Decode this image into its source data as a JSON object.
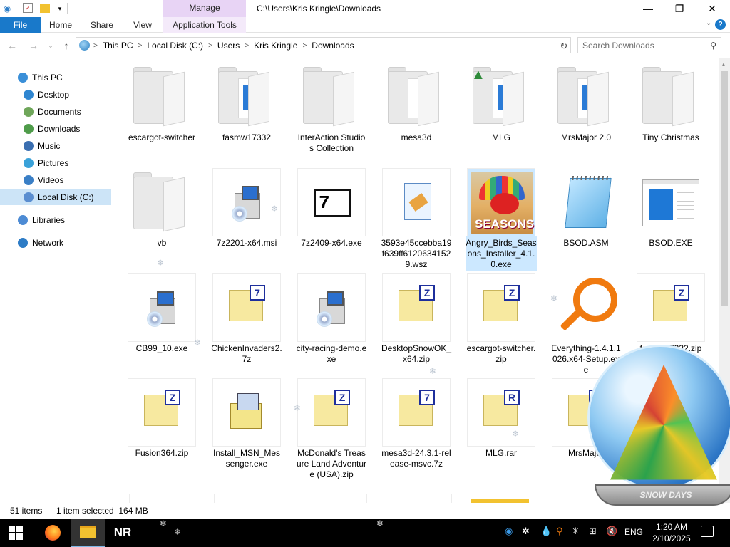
{
  "title_bar": {
    "manage_tab": "Manage",
    "path": "C:\\Users\\Kris Kringle\\Downloads"
  },
  "ribbon": {
    "tabs": [
      "File",
      "Home",
      "Share",
      "View",
      "Application Tools"
    ]
  },
  "address": {
    "crumbs": [
      "This PC",
      "Local Disk (C:)",
      "Users",
      "Kris Kringle",
      "Downloads"
    ],
    "search_placeholder": "Search Downloads"
  },
  "nav": {
    "items": [
      {
        "label": "This PC",
        "icon": "pc-icon",
        "color": "#3a8fd8"
      },
      {
        "label": "Desktop",
        "icon": "desktop-icon",
        "color": "#2f86d1"
      },
      {
        "label": "Documents",
        "icon": "documents-icon",
        "color": "#6fa65a"
      },
      {
        "label": "Downloads",
        "icon": "downloads-icon",
        "color": "#4f9c4a"
      },
      {
        "label": "Music",
        "icon": "music-icon",
        "color": "#3b6fb1"
      },
      {
        "label": "Pictures",
        "icon": "pictures-icon",
        "color": "#3aa2d9"
      },
      {
        "label": "Videos",
        "icon": "videos-icon",
        "color": "#3a7fc6"
      },
      {
        "label": "Local Disk (C:)",
        "icon": "disk-icon",
        "color": "#5b8ed0"
      },
      {
        "label": "Libraries",
        "icon": "libraries-icon",
        "color": "#4d8bd4"
      },
      {
        "label": "Network",
        "icon": "network-icon",
        "color": "#2d7cc6"
      }
    ]
  },
  "files": [
    {
      "name": "escargot-switcher",
      "kind": "folder"
    },
    {
      "name": "fasmw17332",
      "kind": "folder"
    },
    {
      "name": "InterAction Studios Collection",
      "kind": "folder"
    },
    {
      "name": "mesa3d",
      "kind": "folder"
    },
    {
      "name": "MLG",
      "kind": "folder"
    },
    {
      "name": "MrsMajor 2.0",
      "kind": "folder"
    },
    {
      "name": "Tiny Christmas",
      "kind": "folder"
    },
    {
      "name": "vb",
      "kind": "folder"
    },
    {
      "name": "7z2201-x64.msi",
      "kind": "installer"
    },
    {
      "name": "7z2409-x64.exe",
      "kind": "7z-app"
    },
    {
      "name": "3593e45ccebba19f639ff61206341529.wsz",
      "kind": "doc"
    },
    {
      "name": "Angry_Birds_Seasons_Installer_4.1.0.exe",
      "kind": "angry",
      "selected": true
    },
    {
      "name": "BSOD.ASM",
      "kind": "notepad"
    },
    {
      "name": "BSOD.EXE",
      "kind": "bsod"
    },
    {
      "name": "CB99_10.exe",
      "kind": "installer"
    },
    {
      "name": "ChickenInvaders2.7z",
      "kind": "zip",
      "badge": "7"
    },
    {
      "name": "city-racing-demo.exe",
      "kind": "installer"
    },
    {
      "name": "DesktopSnowOK_x64.zip",
      "kind": "zip",
      "badge": "Z"
    },
    {
      "name": "escargot-switcher.zip",
      "kind": "zip",
      "badge": "Z"
    },
    {
      "name": "Everything-1.4.1.1026.x64-Setup.exe",
      "kind": "everything"
    },
    {
      "name": "fasmw17332.zip",
      "kind": "zip",
      "badge": "Z"
    },
    {
      "name": "Fusion364.zip",
      "kind": "zip",
      "badge": "Z"
    },
    {
      "name": "Install_MSN_Messenger.exe",
      "kind": "msn"
    },
    {
      "name": "McDonald's Treasure Land Adventure (USA).zip",
      "kind": "zip",
      "badge": "Z"
    },
    {
      "name": "mesa3d-24.3.1-release-msvc.7z",
      "kind": "zip",
      "badge": "7"
    },
    {
      "name": "MLG.rar",
      "kind": "zip",
      "badge": "R"
    },
    {
      "name": "MrsMajor",
      "kind": "zip",
      "badge": "Z"
    }
  ],
  "status": {
    "items": "51 items",
    "selected": "1 item selected  164 MB"
  },
  "taskbar": {
    "apps": [
      "firefox-icon",
      "file-explorer-icon",
      "NR"
    ],
    "language": "ENG",
    "time": "1:20 AM",
    "date": "2/10/2025"
  },
  "overlay": {
    "globe_base_text": "SNOW DAYS"
  }
}
